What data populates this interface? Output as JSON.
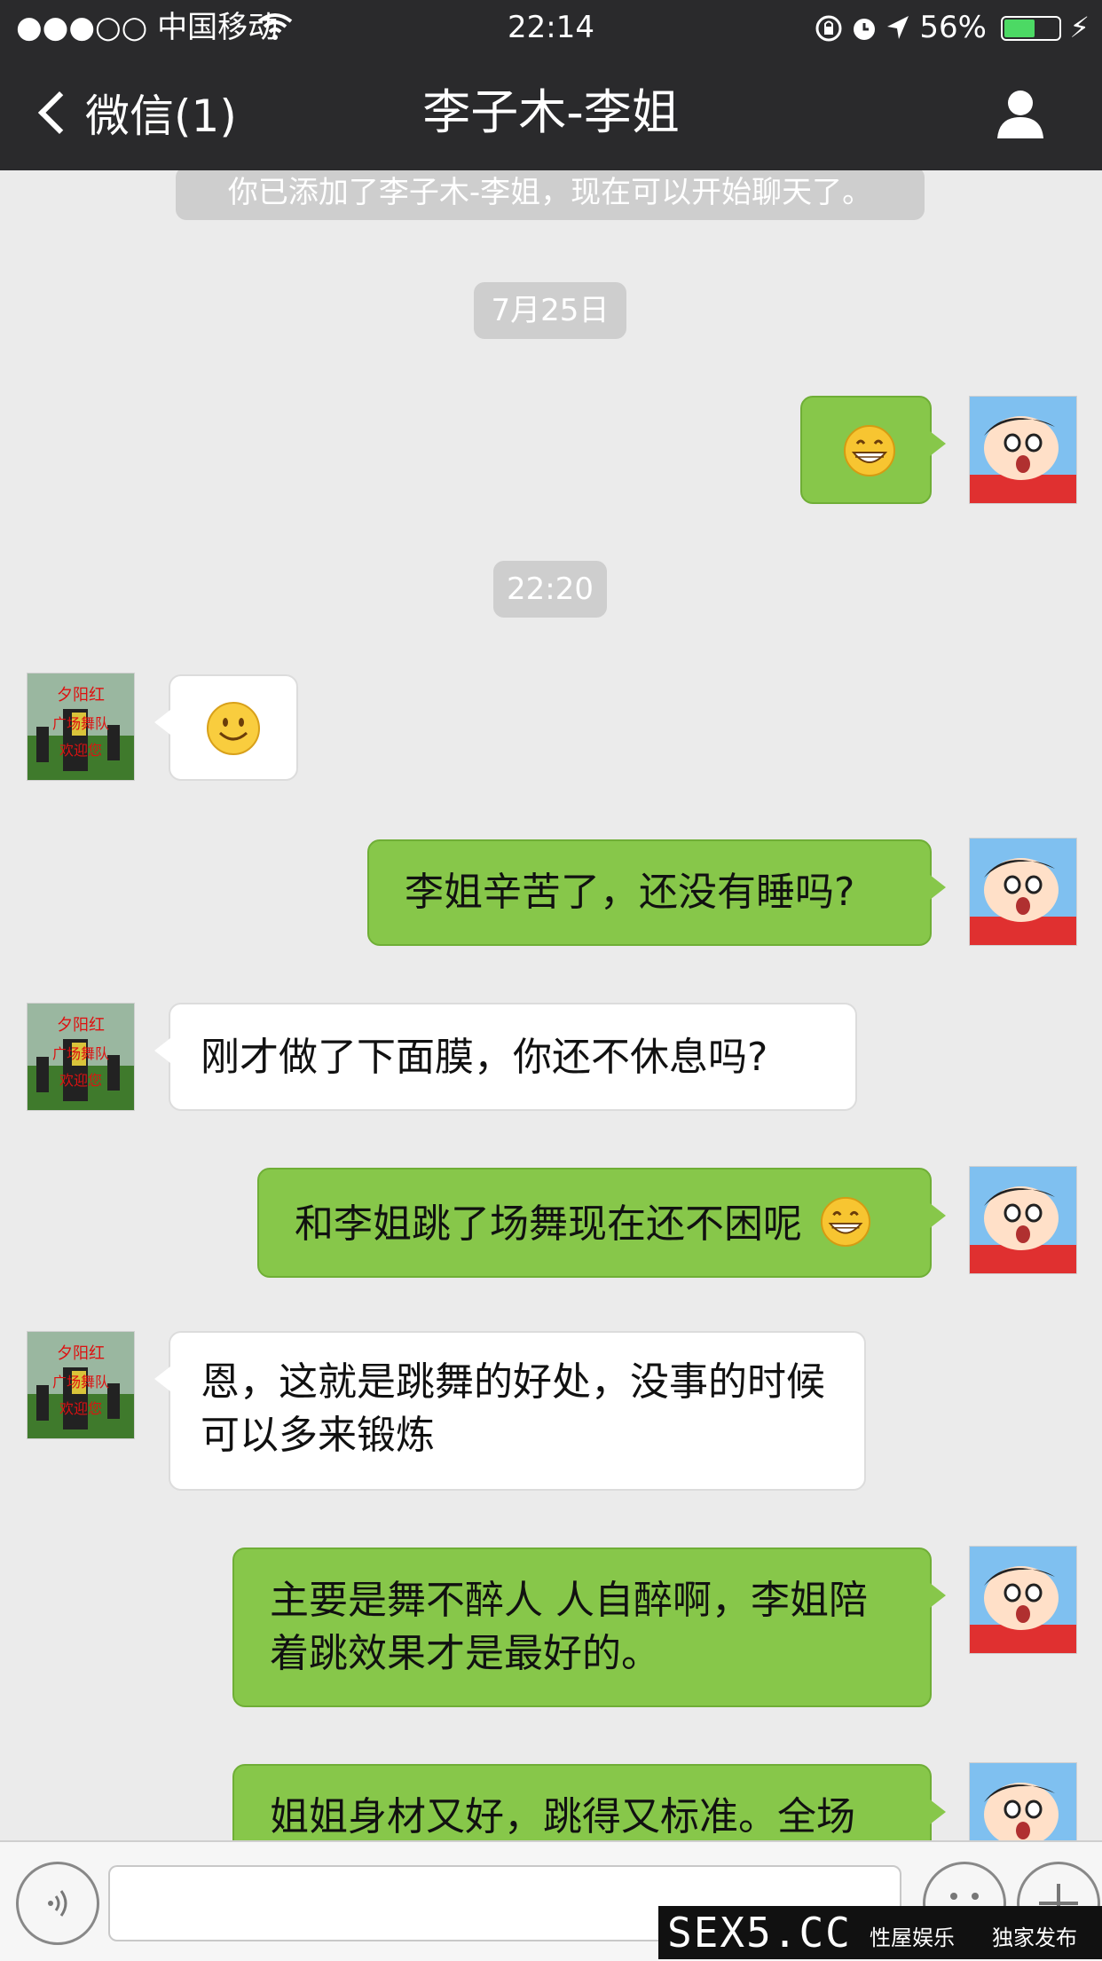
{
  "status_bar": {
    "carrier": "●●●○○ 中国移动",
    "time": "22:14",
    "battery_text": "56%",
    "battery_level": 0.56
  },
  "nav": {
    "back_label": "微信(1)",
    "title": "李子木-李姐"
  },
  "system_messages": {
    "added_notice": "你已添加了李子木-李姐，现在可以开始聊天了。",
    "date1": "7月25日",
    "time1": "22:20"
  },
  "avatars": {
    "contact_avatar_text": "夕阳红 广场舞队 欢迎您"
  },
  "messages": [
    {
      "from": "me",
      "text": "",
      "emoji": "grin"
    },
    {
      "from": "them",
      "text": "",
      "emoji": "smile"
    },
    {
      "from": "me",
      "text": "李姐辛苦了，还没有睡吗?"
    },
    {
      "from": "them",
      "text": "刚才做了下面膜，你还不休息吗?"
    },
    {
      "from": "me",
      "text": "和李姐跳了场舞现在还不困呢",
      "emoji": "grin"
    },
    {
      "from": "them",
      "text": "恩，这就是跳舞的好处，没事的时候可以多来锻炼"
    },
    {
      "from": "me",
      "text": "主要是舞不醉人 人自醉啊，李姐陪着跳效果才是最好的。"
    },
    {
      "from": "me",
      "text": "姐姐身材又好，跳得又标准。全场"
    }
  ],
  "input_bar": {
    "placeholder": ""
  },
  "watermark": {
    "logo": "SEX5.CC",
    "tag1": "性屋娱乐",
    "tag2": "独家发布"
  },
  "colors": {
    "nav_bg": "#2a2a2c",
    "chat_bg": "#ebebeb",
    "my_bubble": "#87c74a",
    "their_bubble": "#ffffff",
    "battery_green": "#4cd964"
  },
  "icons": [
    "back-chevron-icon",
    "wifi-icon",
    "lock-rotation-icon",
    "alarm-icon",
    "location-icon",
    "charging-icon",
    "person-icon",
    "voice-icon",
    "emoji-icon",
    "plus-icon"
  ]
}
